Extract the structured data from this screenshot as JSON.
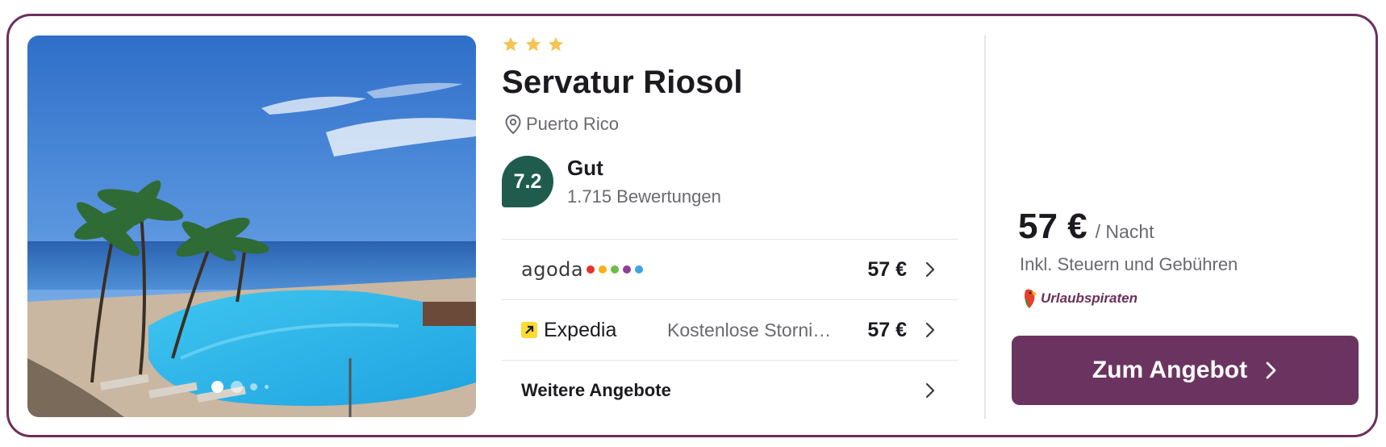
{
  "hotel": {
    "stars": 3,
    "name": "Servatur Riosol",
    "location": "Puerto Rico",
    "rating": {
      "score": "7.2",
      "label": "Gut",
      "reviews": "1.715 Bewertungen"
    }
  },
  "gallery": {
    "current_slide": 1,
    "dots_visible": 4
  },
  "offers": [
    {
      "provider": "agoda",
      "price": "57 €",
      "note": ""
    },
    {
      "provider": "Expedia",
      "price": "57 €",
      "note": "Kostenlose Storni…"
    }
  ],
  "more_offers_label": "Weitere Angebote",
  "best_price": {
    "price": "57 €",
    "unit": "/ Nacht",
    "taxes": "Inkl. Steuern und Gebühren",
    "partner": "Urlaubspiraten"
  },
  "cta_label": "Zum Angebot",
  "colors": {
    "border": "#6b2f5c",
    "cta": "#6b3460",
    "rating_badge": "#1f5c4d",
    "star": "#f5c451",
    "agoda_dots": [
      "#e5322d",
      "#f6b21a",
      "#71bc44",
      "#8f3f97",
      "#3fa4e1"
    ],
    "expedia_logo": "#fddb32"
  },
  "icons": [
    "star-icon",
    "location-pin-icon",
    "chevron-right-icon",
    "expedia-arrow-icon",
    "parrot-logo-icon"
  ]
}
